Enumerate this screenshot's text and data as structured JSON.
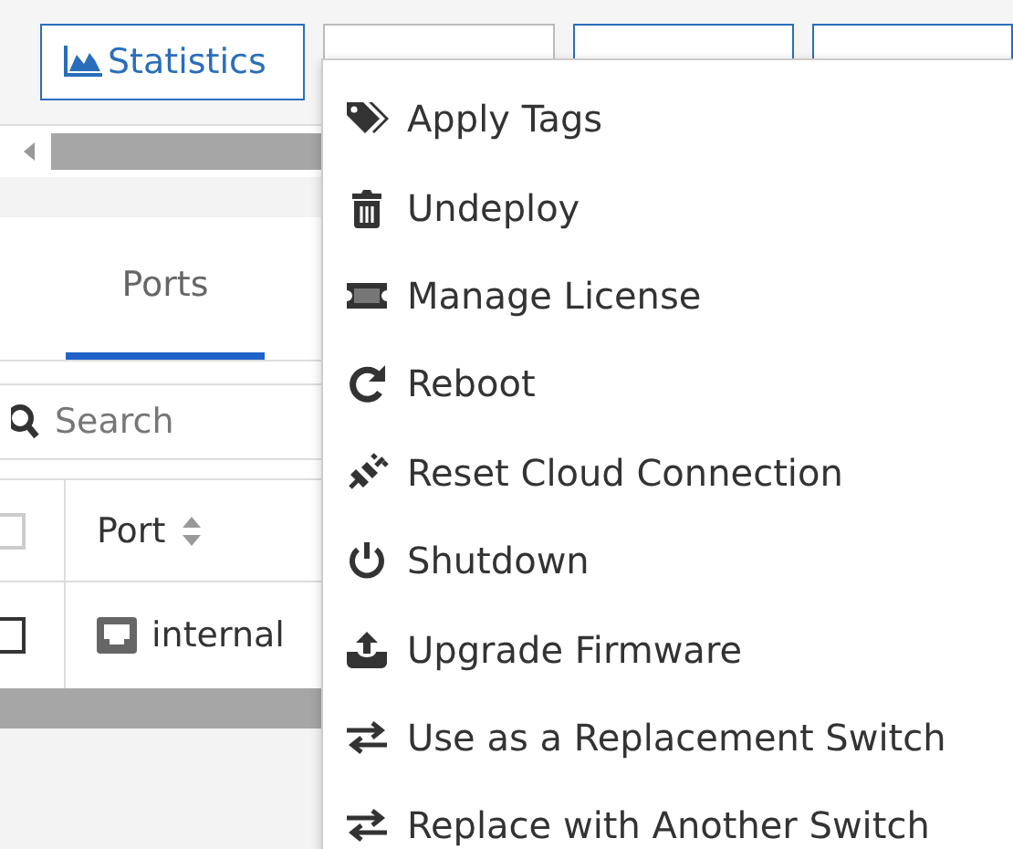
{
  "toolbar": {
    "buttons": [
      {
        "label": "Statistics",
        "kind": "stats",
        "open": false
      },
      {
        "kind": "plain",
        "open": true
      },
      {
        "kind": "plain",
        "open": false
      },
      {
        "kind": "plain",
        "open": false
      }
    ]
  },
  "tabs": [
    {
      "label": "Ports",
      "selected": true
    }
  ],
  "search": {
    "placeholder": "Search"
  },
  "table": {
    "header_checked": false,
    "columns": [
      {
        "kind": "check"
      },
      {
        "kind": "text",
        "label": "Port",
        "sortable": true
      }
    ],
    "rows": [
      {
        "checked": false,
        "port": "internal"
      }
    ]
  },
  "menu": {
    "items": [
      {
        "label": "Apply Tags",
        "kind": "tags"
      },
      {
        "label": "Undeploy",
        "kind": "trash"
      },
      {
        "label": "Manage License",
        "kind": "ticket"
      },
      {
        "label": "Reboot",
        "kind": "redo"
      },
      {
        "label": "Reset Cloud Connection",
        "kind": "plug"
      },
      {
        "label": "Shutdown",
        "kind": "power"
      },
      {
        "label": "Upgrade Firmware",
        "kind": "upload"
      },
      {
        "label": "Use as a Replacement Switch",
        "kind": "swap"
      },
      {
        "label": "Replace with Another Switch",
        "kind": "swap"
      }
    ]
  }
}
